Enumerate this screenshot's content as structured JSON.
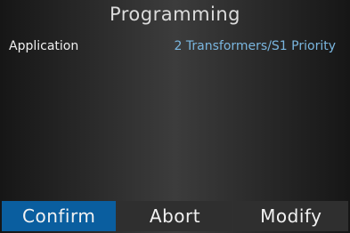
{
  "screen": {
    "title": "Programming"
  },
  "parameter": {
    "label": "Application",
    "value": "2 Transformers/S1 Priority"
  },
  "softkeys": [
    {
      "label": "Confirm",
      "selected": true
    },
    {
      "label": "Abort",
      "selected": false
    },
    {
      "label": "Modify",
      "selected": false
    }
  ],
  "colors": {
    "selected_key": "#0a5e9f",
    "value_text": "#7ab6df",
    "key_background": "#2f2f2f"
  }
}
